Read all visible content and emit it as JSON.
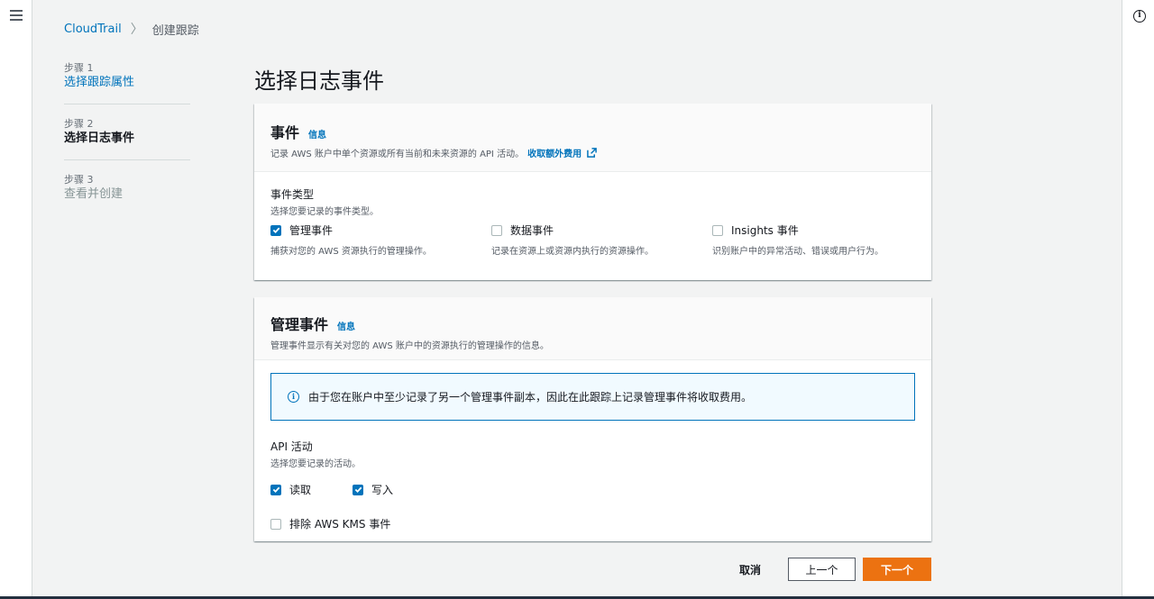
{
  "breadcrumb": {
    "root": "CloudTrail",
    "current": "创建跟踪"
  },
  "steps": [
    {
      "num": "步骤 1",
      "title": "选择跟踪属性"
    },
    {
      "num": "步骤 2",
      "title": "选择日志事件"
    },
    {
      "num": "步骤 3",
      "title": "查看并创建"
    }
  ],
  "page_title": "选择日志事件",
  "events_panel": {
    "title": "事件",
    "info": "信息",
    "description": "记录 AWS 账户中单个资源或所有当前和未来资源的 API 活动。",
    "extra_cost_link": "收取额外费用",
    "event_type_label": "事件类型",
    "event_type_desc": "选择您要记录的事件类型。",
    "options": [
      {
        "label": "管理事件",
        "desc": "捕获对您的 AWS 资源执行的管理操作。",
        "checked": true
      },
      {
        "label": "数据事件",
        "desc": "记录在资源上或资源内执行的资源操作。",
        "checked": false
      },
      {
        "label": "Insights 事件",
        "desc": "识别账户中的异常活动、错误或用户行为。",
        "checked": false
      }
    ]
  },
  "mgmt_panel": {
    "title": "管理事件",
    "info": "信息",
    "description": "管理事件显示有关对您的 AWS 账户中的资源执行的管理操作的信息。",
    "alert": "由于您在账户中至少记录了另一个管理事件副本，因此在此跟踪上记录管理事件将收取费用。",
    "api_label": "API 活动",
    "api_desc": "选择您要记录的活动。",
    "read_label": "读取",
    "write_label": "写入",
    "exclude_kms_label": "排除 AWS KMS 事件"
  },
  "actions": {
    "cancel": "取消",
    "prev": "上一个",
    "next": "下一个"
  },
  "colors": {
    "link": "#0073bb",
    "primary": "#ec7211",
    "background": "#f2f3f3"
  }
}
